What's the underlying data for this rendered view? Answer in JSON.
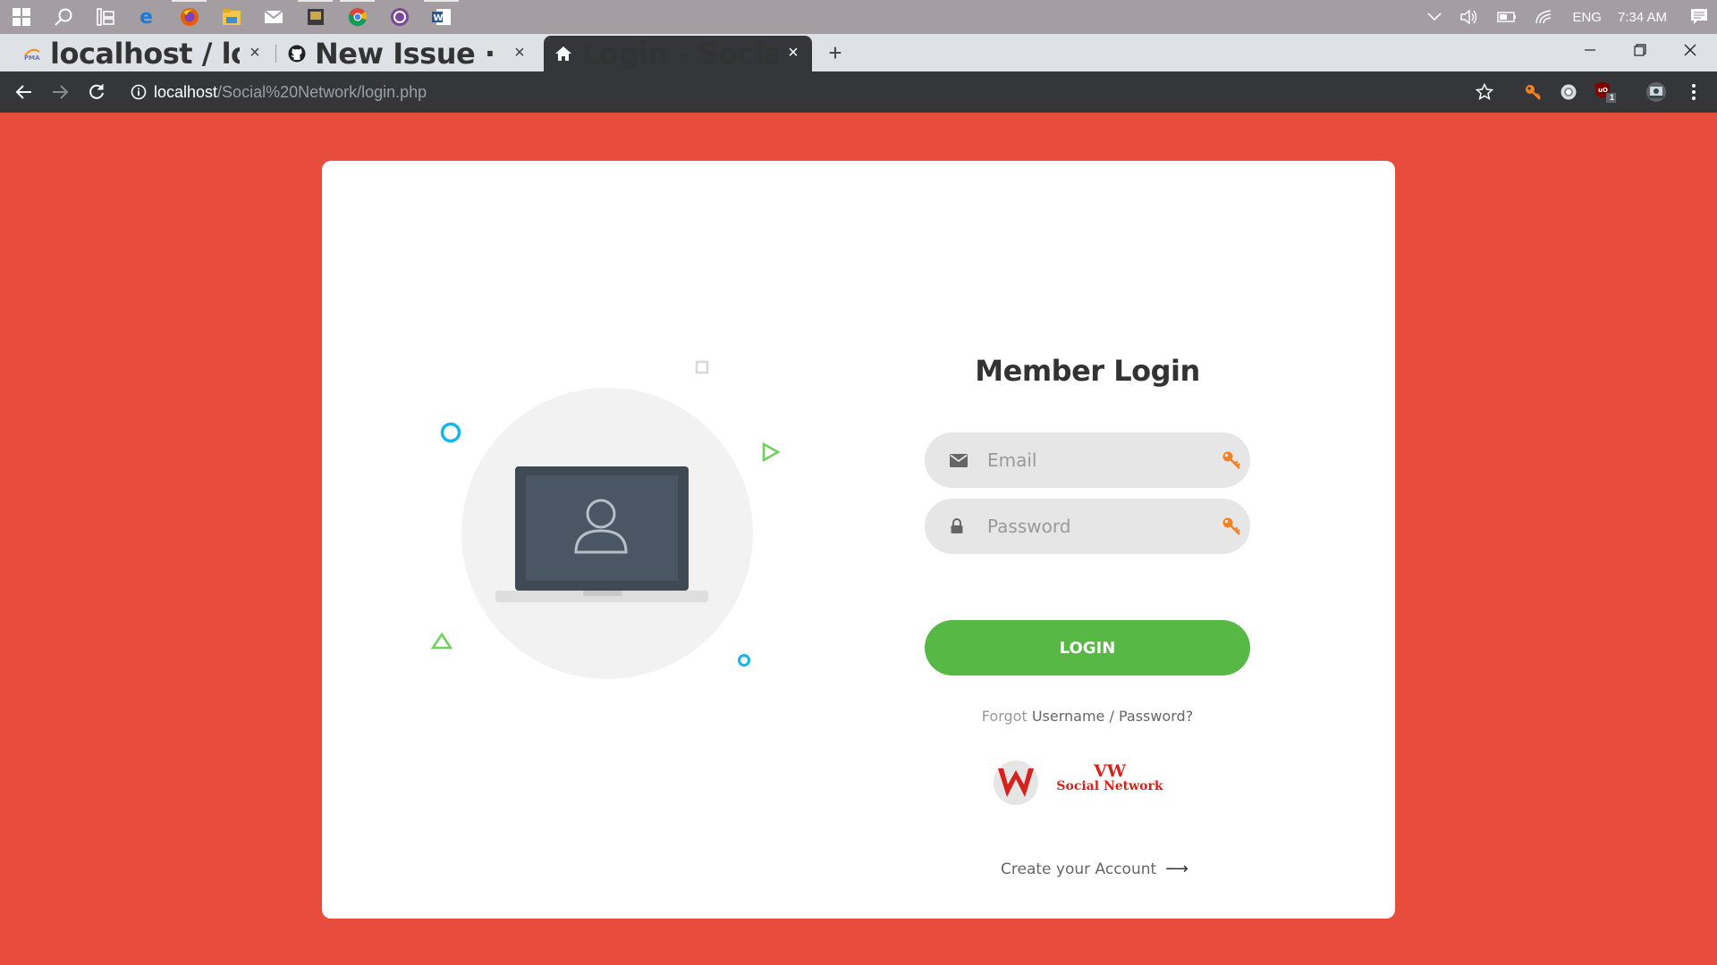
{
  "taskbar": {
    "icons": [
      "windows-start-icon",
      "search-icon",
      "task-view-icon",
      "edge-icon",
      "firefox-icon",
      "file-explorer-icon",
      "mail-icon",
      "media-app-icon",
      "chrome-icon",
      "tor-browser-icon",
      "word-icon"
    ],
    "tray": {
      "language": "ENG",
      "time": "7:34 AM"
    }
  },
  "browser": {
    "tabs": [
      {
        "title": "localhost / localhost / social / users",
        "icon": "phpmyadmin-icon",
        "active": false
      },
      {
        "title": "New Issue · dukemido/social-network",
        "icon": "github-icon",
        "active": false
      },
      {
        "title": "Login - Social Network",
        "icon": "home-icon",
        "active": true
      }
    ],
    "new_tab": "+",
    "url": {
      "host": "localhost",
      "path": "/Social%20Network/login.php"
    },
    "extension_badge": "1"
  },
  "login": {
    "title": "Member Login",
    "email_placeholder": "Email",
    "password_placeholder": "Password",
    "button": "LOGIN",
    "forgot_prefix": "Forgot",
    "forgot_username": "Username",
    "forgot_sep": " / ",
    "forgot_password": "Password?",
    "logo_line1": "VW",
    "logo_line2": "Social Network",
    "create_account": "Create your Account",
    "create_arrow": "⟶"
  },
  "colors": {
    "page_bg": "#e74c3c",
    "button": "#57b846",
    "accent_cyan": "#14b7e8",
    "accent_green": "#6fcf5f"
  }
}
